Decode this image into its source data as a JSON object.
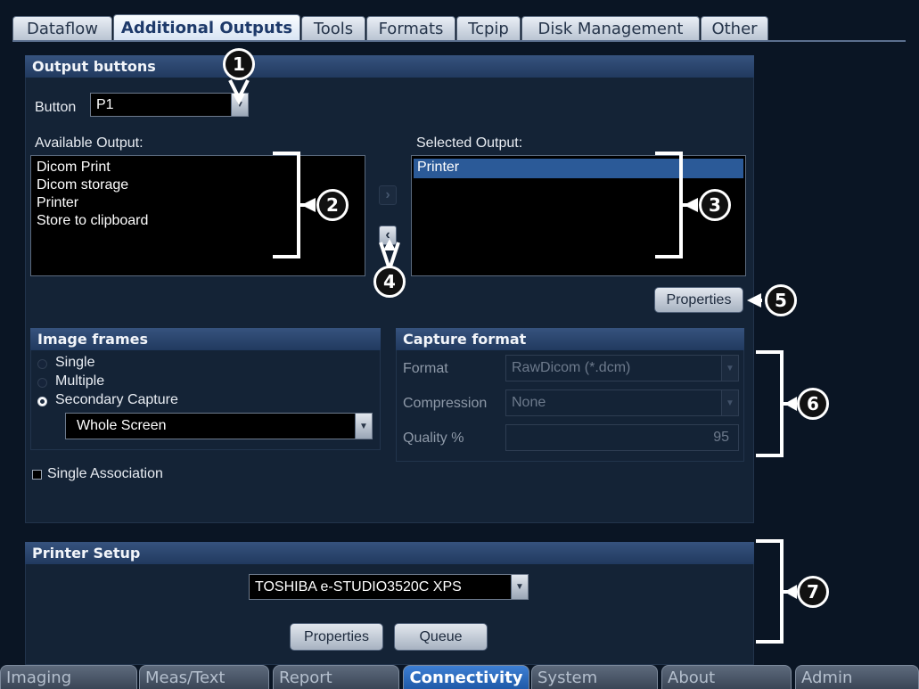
{
  "top_tabs": [
    "Dataflow",
    "Additional Outputs",
    "Tools",
    "Formats",
    "Tcpip",
    "Disk Management",
    "Other"
  ],
  "output_buttons": {
    "header": "Output buttons",
    "button_label": "Button",
    "button_value": "P1",
    "available_label": "Available Output:",
    "available_items": [
      "Dicom Print",
      "Dicom storage",
      "Printer",
      "Store to clipboard"
    ],
    "selected_label": "Selected Output:",
    "selected_items": [
      "Printer"
    ],
    "add_arrow": "›",
    "remove_arrow": "‹",
    "properties_label": "Properties"
  },
  "image_frames": {
    "header": "Image frames",
    "options": [
      "Single",
      "Multiple",
      "Secondary Capture"
    ],
    "selected_option": "Secondary Capture",
    "capture_area": "Whole Screen",
    "single_association_label": "Single Association",
    "single_association_checked": false
  },
  "capture_format": {
    "header": "Capture format",
    "format_label": "Format",
    "format_value": "RawDicom (*.dcm)",
    "compression_label": "Compression",
    "compression_value": "None",
    "quality_label": "Quality %",
    "quality_value": "95"
  },
  "printer_setup": {
    "header": "Printer Setup",
    "printer_value": "TOSHIBA e-STUDIO3520C XPS",
    "properties_label": "Properties",
    "queue_label": "Queue"
  },
  "callouts": [
    "1",
    "2",
    "3",
    "4",
    "5",
    "6",
    "7"
  ],
  "bottom_tabs": [
    "Imaging",
    "Meas/Text",
    "Report",
    "Connectivity",
    "System",
    "About",
    "Admin"
  ],
  "active_bottom_tab": "Connectivity",
  "colors": {
    "header_blue": "#2a4670",
    "selection_blue": "#2b5a98",
    "active_tab_blue": "#1f5aa8",
    "panel_bg": "#142336"
  },
  "icons": {
    "dropdown": "chevron-down-icon",
    "add": "chevron-right-icon",
    "remove": "chevron-left-icon"
  }
}
